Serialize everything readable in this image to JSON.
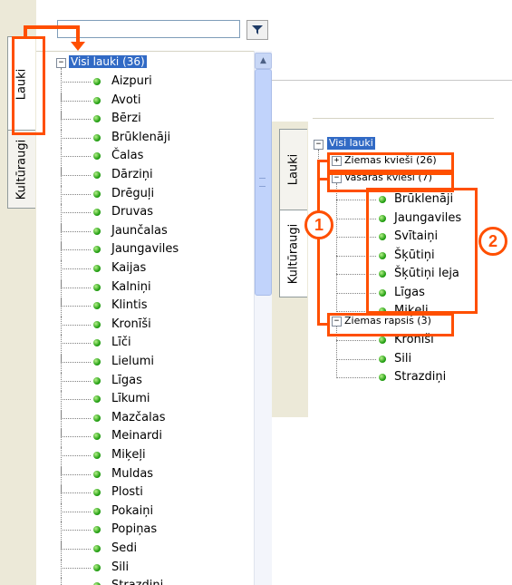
{
  "left": {
    "tabs": [
      "Lauki",
      "Kultūraugi"
    ],
    "root_label": "Visi lauki (36)",
    "fields": [
      "Aizpuri",
      "Avoti",
      "Bērzi",
      "Brūklenāji",
      "Čalas",
      "Dārziņi",
      "Drēguļi",
      "Druvas",
      "Jaunčalas",
      "Jaungaviles",
      "Kaijas",
      "Kalniņi",
      "Klintis",
      "Kronīši",
      "Līči",
      "Lielumi",
      "Līgas",
      "Līkumi",
      "Mazčalas",
      "Meinardi",
      "Miķeļi",
      "Muldas",
      "Plosti",
      "Pokaiņi",
      "Popiņas",
      "Sedi",
      "Sili",
      "Strazdiņi"
    ]
  },
  "right": {
    "tabs": [
      "Lauki",
      "Kultūraugi"
    ],
    "root_label": "Visi lauki",
    "groups": [
      {
        "label": "Ziemas kvieši (26)",
        "expander": "+",
        "items": []
      },
      {
        "label": "Vasaras kvieši (7)",
        "expander": "−",
        "items": [
          "Brūklenāji",
          "Jaungaviles",
          "Svītaiņi",
          "Šķūtiņi",
          "Šķūtiņi leja",
          "Līgas",
          "Miķeļi"
        ]
      },
      {
        "label": "Ziemas rapsis (3)",
        "expander": "−",
        "items": [
          "Kronīši",
          "Sili",
          "Strazdiņi"
        ]
      }
    ]
  },
  "callouts": {
    "one": "1",
    "two": "2"
  },
  "colors": {
    "accent": "#ff4f00",
    "selection": "#316ac5",
    "dot": "#1d9a0e"
  },
  "icons": {
    "filter": "filter-icon"
  }
}
